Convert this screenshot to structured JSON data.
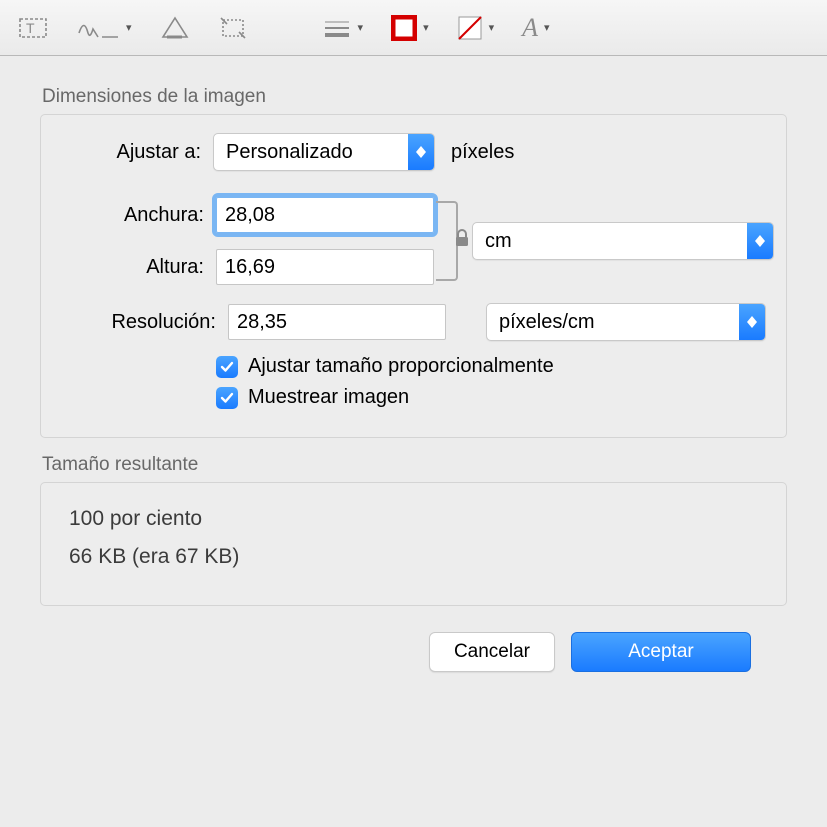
{
  "toolbar": {
    "tools": [
      "text-box",
      "signature",
      "shapes",
      "crop",
      "line-style",
      "border-color",
      "fill-color",
      "font-style"
    ]
  },
  "dimensions": {
    "section_title": "Dimensiones de la imagen",
    "fit_label": "Ajustar a:",
    "fit_value": "Personalizado",
    "fit_unit_label": "píxeles",
    "width_label": "Anchura:",
    "width_value": "28,08",
    "height_label": "Altura:",
    "height_value": "16,69",
    "size_unit": "cm",
    "resolution_label": "Resolución:",
    "resolution_value": "28,35",
    "resolution_unit": "píxeles/cm",
    "scale_proportional_label": "Ajustar tamaño proporcionalmente",
    "scale_proportional_checked": true,
    "resample_label": "Muestrear imagen",
    "resample_checked": true
  },
  "result": {
    "section_title": "Tamaño resultante",
    "percent_line": "100 por ciento",
    "size_line": "66 KB (era 67 KB)"
  },
  "buttons": {
    "cancel": "Cancelar",
    "ok": "Aceptar"
  }
}
